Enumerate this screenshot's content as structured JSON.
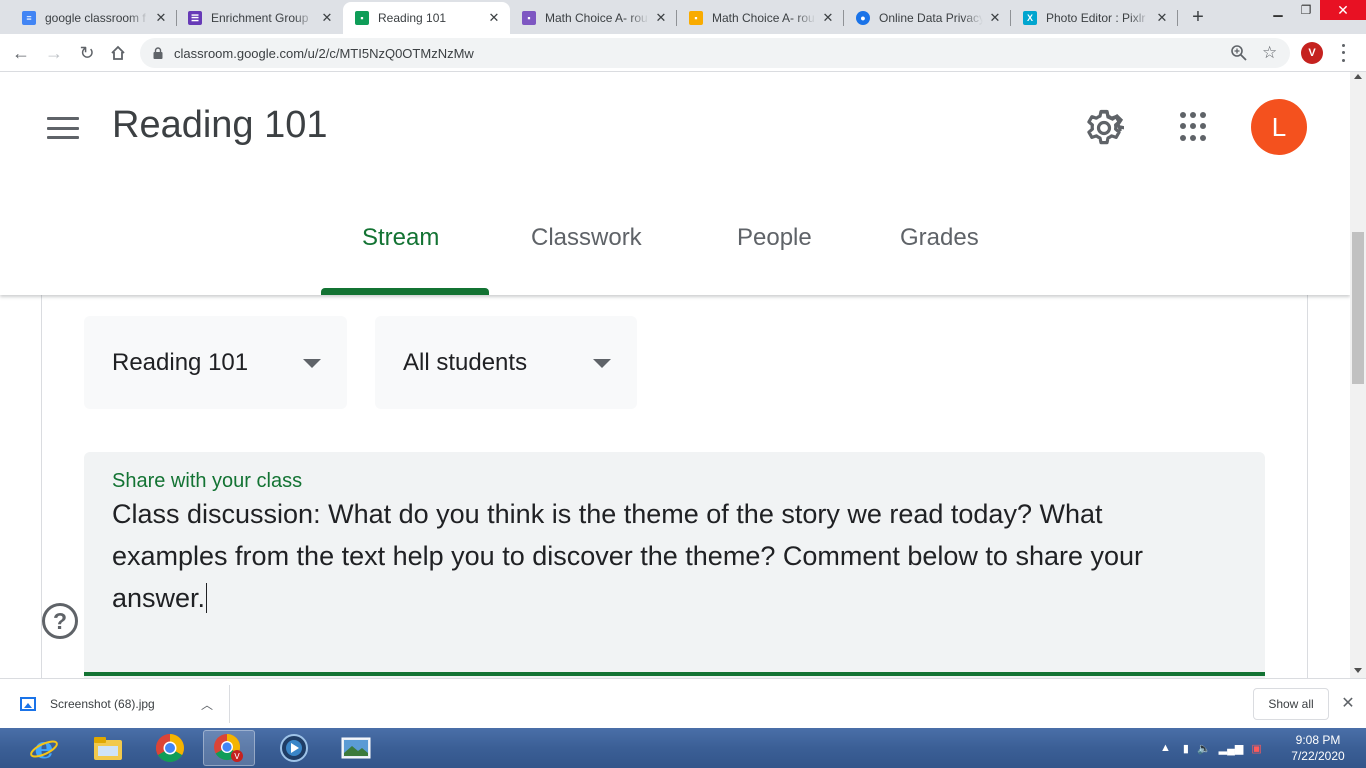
{
  "browser": {
    "tabs": [
      {
        "title": "google classroom f",
        "icon": "google-search-icon",
        "color": "#4285f4",
        "active": false
      },
      {
        "title": "Enrichment Group",
        "icon": "google-forms-icon",
        "color": "#673ab7",
        "active": false
      },
      {
        "title": "Reading 101",
        "icon": "google-classroom-icon",
        "color": "#0f9d58",
        "active": true
      },
      {
        "title": "Math Choice A- rou",
        "icon": "google-classroom-icon",
        "color": "#7e57c2",
        "active": false
      },
      {
        "title": "Math Choice A- rou",
        "icon": "google-classroom-icon",
        "color": "#f9ab00",
        "active": false
      },
      {
        "title": "Online Data Privacy",
        "icon": "google-sites-icon",
        "color": "#1a73e8",
        "active": false
      },
      {
        "title": "Photo Editor : Pixlr",
        "icon": "pixlr-icon",
        "color": "#00a5cf",
        "active": false
      }
    ],
    "url": "classroom.google.com/u/2/c/MTI5NzQ0OTMzNzMw",
    "profile_initial": "V"
  },
  "classroom": {
    "class_title": "Reading 101",
    "account_initial": "L",
    "accent_color": "#137333",
    "nav_tabs": [
      "Stream",
      "Classwork",
      "People",
      "Grades"
    ],
    "active_tab": "Stream",
    "class_filter": "Reading 101",
    "audience_filter": "All students",
    "composer": {
      "label": "Share with your class",
      "text": "Class discussion: What do you think is the theme of the story we read today? What examples from the text help you to discover the theme? Comment below to share your answer."
    }
  },
  "downloads": {
    "file_name": "Screenshot (68).jpg",
    "show_all_label": "Show all"
  },
  "taskbar": {
    "time": "9:08 PM",
    "date": "7/22/2020",
    "apps": [
      "internet-explorer-icon",
      "file-explorer-icon",
      "chrome-icon",
      "chrome-profile-icon",
      "media-player-icon",
      "photo-viewer-icon"
    ]
  }
}
